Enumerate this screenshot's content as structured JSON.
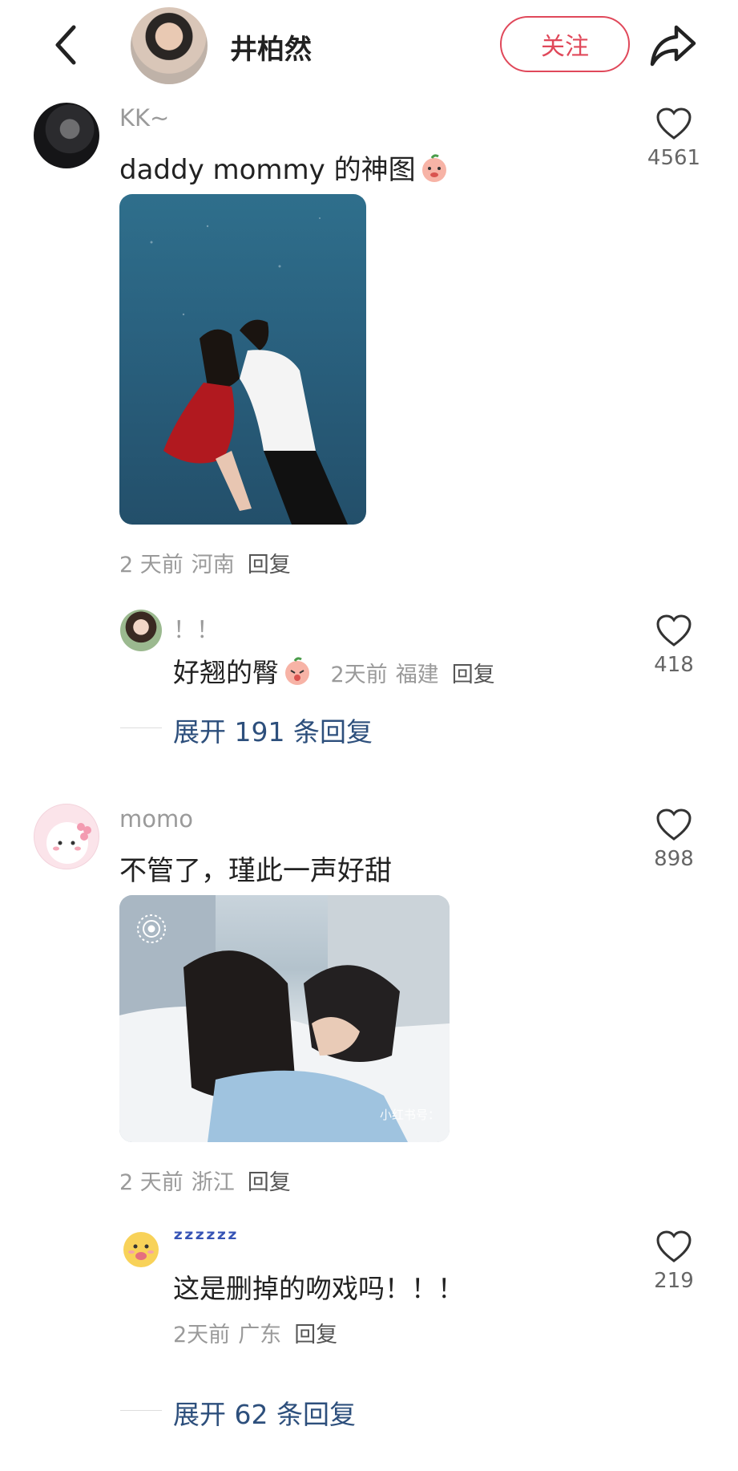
{
  "header": {
    "back_icon": "chevron-left-icon",
    "title": "井柏然",
    "follow_label": "关注",
    "share_icon": "share-icon",
    "accent_color": "#e0485a"
  },
  "comments": [
    {
      "username": "KK~",
      "content": "daddy mommy 的神图",
      "emoji_icon": "peach-shy-emoji-icon",
      "likes": "4561",
      "time": "2 天前",
      "location": "河南",
      "reply_label": "回复",
      "reply": {
        "username": "！！",
        "content": "好翘的臀",
        "emoji_icon": "peach-emoji-icon",
        "time": "2天前",
        "location": "福建",
        "reply_label": "回复",
        "likes": "418"
      },
      "expand_label": "展开 191 条回复"
    },
    {
      "username": "momo",
      "content": "不管了，瑾此一声好甜",
      "likes": "898",
      "image_watermark": "小红书号：",
      "live_icon": "live-photo-icon",
      "time": "2 天前",
      "location": "浙江",
      "reply_label": "回复",
      "reply": {
        "username": "ᶻᶻᶻᶻᶻᶻ",
        "content": "这是删掉的吻戏吗！！！",
        "time": "2天前",
        "location": "广东",
        "reply_label": "回复",
        "likes": "219"
      },
      "expand_label": "展开 62 条回复"
    }
  ]
}
